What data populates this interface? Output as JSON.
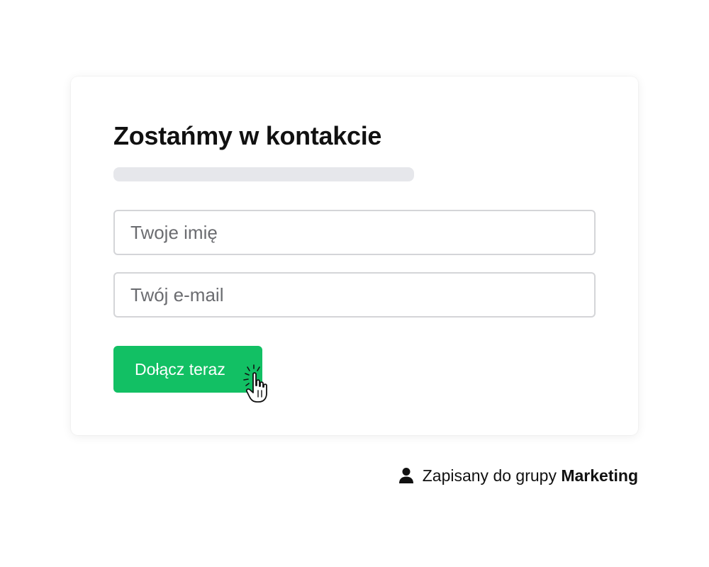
{
  "form": {
    "title": "Zostańmy w kontakcie",
    "name_field": {
      "placeholder": "Twoje imię",
      "value": ""
    },
    "email_field": {
      "placeholder": "Twój e-mail",
      "value": ""
    },
    "submit_label": "Dołącz teraz"
  },
  "footer": {
    "icon": "user-icon",
    "status_prefix": "Zapisany do grupy",
    "group_name": "Marketing"
  },
  "colors": {
    "accent": "#12c064",
    "skeleton": "#e6e7eb",
    "border": "#d4d5d8"
  }
}
